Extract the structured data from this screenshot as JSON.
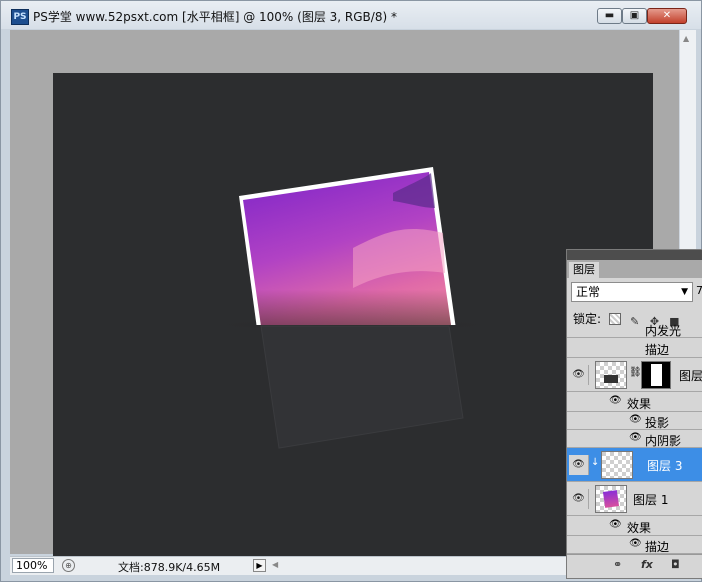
{
  "window": {
    "app_icon": "PS",
    "title": "PS学堂 www.52psxt.com [水平相框] @ 100% (图层 3, RGB/8) *",
    "controls": {
      "minimize": "▬",
      "maximize": "▣",
      "close": "✕"
    }
  },
  "status": {
    "zoom": "100%",
    "doc_info": "文档:878.9K/4.65M"
  },
  "layers_panel": {
    "tab": "图层",
    "blend_mode": "正常",
    "blend_extra": "7",
    "lock_label": "锁定:",
    "rows": [
      {
        "label": "内发光"
      },
      {
        "label": "描边"
      },
      {
        "label": "图层"
      },
      {
        "label": "效果"
      },
      {
        "label": "投影"
      },
      {
        "label": "内阴影"
      },
      {
        "label": "图层 3"
      },
      {
        "label": "图层 1"
      },
      {
        "label": "效果"
      },
      {
        "label": "描边"
      }
    ],
    "footer_icons": [
      "link-icon",
      "fx-icon",
      "mask-icon"
    ]
  },
  "colors": {
    "canvas": "#2c2d2f",
    "selected_row": "#3d8ee6",
    "photo_top": "#8a2fd6",
    "photo_bottom": "#d84f9e"
  }
}
